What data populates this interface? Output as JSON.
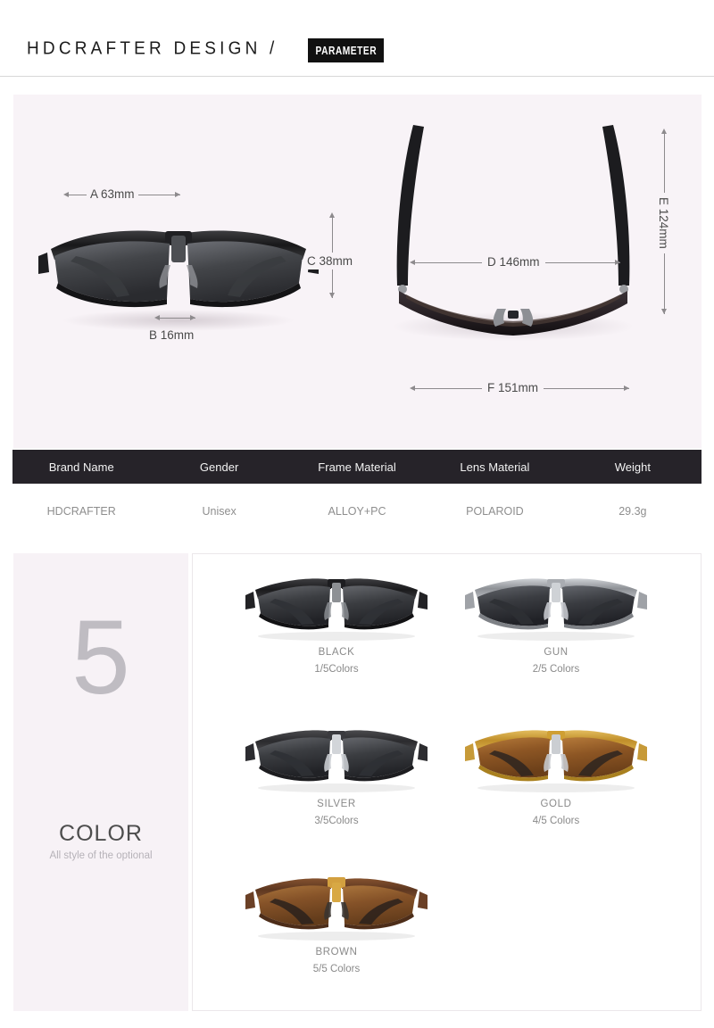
{
  "header": {
    "brand_title": "HDCRAFTER DESIGN /",
    "badge_label": "PARAMETER"
  },
  "diagram": {
    "front_view": {
      "measurements": [
        {
          "id": "A",
          "label": "A 63mm",
          "axis": "horizontal"
        },
        {
          "id": "B",
          "label": "B 16mm",
          "axis": "horizontal"
        },
        {
          "id": "C",
          "label": "C 38mm",
          "axis": "vertical"
        }
      ]
    },
    "top_view": {
      "measurements": [
        {
          "id": "D",
          "label": "D 146mm",
          "axis": "horizontal"
        },
        {
          "id": "E",
          "label": "E 124mm",
          "axis": "vertical"
        },
        {
          "id": "F",
          "label": "F 151mm",
          "axis": "horizontal"
        }
      ]
    }
  },
  "spec_table": {
    "headers": [
      "Brand Name",
      "Gender",
      "Frame Material",
      "Lens Material",
      "Weight"
    ],
    "row": [
      "HDCRAFTER",
      "Unisex",
      "ALLOY+PC",
      "POLAROID",
      "29.3g"
    ]
  },
  "color_section": {
    "count": "5",
    "title": "COLOR",
    "subtitle": "All style of the optional",
    "swatches": [
      {
        "name": "BLACK",
        "count": "1/5Colors",
        "frame": "#2b2b2d",
        "lens": "#2f3034",
        "bridge": "#8d9094"
      },
      {
        "name": "GUN",
        "count": "2/5 Colors",
        "frame": "#9a9da2",
        "lens": "#303136",
        "bridge": "#c3c6ca"
      },
      {
        "name": "SILVER",
        "count": "3/5Colors",
        "frame": "#3a3a3c",
        "lens": "#303136",
        "bridge": "#c9ccd0"
      },
      {
        "name": "GOLD",
        "count": "4/5 Colors",
        "frame": "#c8922e",
        "lens": "#8a5a26",
        "bridge": "#e0b450"
      },
      {
        "name": "BROWN",
        "count": "5/5 Colors",
        "frame": "#6b4026",
        "lens": "#8a5429",
        "bridge": "#d3a03f"
      }
    ]
  }
}
